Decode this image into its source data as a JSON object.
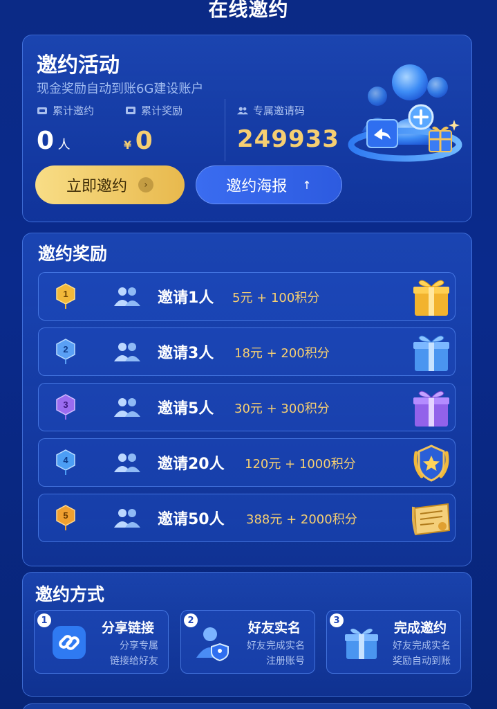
{
  "header": {
    "title": "在线邀约"
  },
  "activity": {
    "title": "邀约活动",
    "subtitle": "现金奖励自动到账6G建设账户",
    "total_invites_label": "累计邀约",
    "total_invites_value": "0",
    "total_invites_unit": "人",
    "total_rewards_label": "累计奖励",
    "total_rewards_currency": "¥",
    "total_rewards_value": "0",
    "invite_code_label": "专属邀请码",
    "invite_code": "249933",
    "invite_now_label": "立即邀约",
    "poster_label": "邀约海报",
    "poster_icon": "↑"
  },
  "rewards": {
    "title": "邀约奖励",
    "items": [
      {
        "rank": "1",
        "label": "邀请1人",
        "reward": "5元 + 100积分",
        "medal_color": "#f2b93a",
        "prize_icon": "gold-gift-icon"
      },
      {
        "rank": "2",
        "label": "邀请3人",
        "reward": "18元 + 200积分",
        "medal_color": "#5aa0f5",
        "prize_icon": "blue-gift-icon"
      },
      {
        "rank": "3",
        "label": "邀请5人",
        "reward": "30元 + 300积分",
        "medal_color": "#9a6cf0",
        "prize_icon": "purple-gift-icon"
      },
      {
        "rank": "4",
        "label": "邀请20人",
        "reward": "120元 + 1000积分",
        "medal_color": "#4c9ef5",
        "prize_icon": "star-badge-icon"
      },
      {
        "rank": "5",
        "label": "邀请50人",
        "reward": "388元 + 2000积分",
        "medal_color": "#f0a030",
        "prize_icon": "certificate-icon"
      }
    ]
  },
  "methods": {
    "title": "邀约方式",
    "items": [
      {
        "num": "1",
        "title": "分享链接",
        "desc1": "分享专属",
        "desc2": "链接给好友",
        "icon": "link-icon"
      },
      {
        "num": "2",
        "title": "好友实名",
        "desc1": "好友完成实名",
        "desc2": "注册账号",
        "icon": "user-verify-icon"
      },
      {
        "num": "3",
        "title": "完成邀约",
        "desc1": "好友完成实名",
        "desc2": "奖励自动到账",
        "icon": "gift-icon"
      }
    ]
  },
  "colors": {
    "background": "#0b2a86",
    "accent_gold": "#f6cf72",
    "button_gold": "#f0c862",
    "button_blue": "#3563ea",
    "card_border": "#6096ff"
  }
}
